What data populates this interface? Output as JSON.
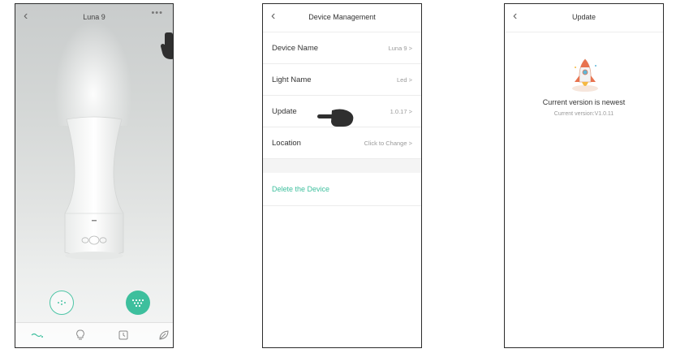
{
  "screen1": {
    "title": "Luna 9",
    "back_icon": "chevron-left-icon",
    "more_label": "•••",
    "mist_buttons": [
      "mist-low-icon",
      "mist-high-icon"
    ],
    "tabs": [
      "mist-tab-icon",
      "light-bulb-icon",
      "alarm-clock-icon",
      "leaf-icon"
    ],
    "accent": "#3dbf9d"
  },
  "screen2": {
    "title": "Device Management",
    "rows": [
      {
        "label": "Device Name",
        "value": "Luna 9 >"
      },
      {
        "label": "Light Name",
        "value": "Led >"
      },
      {
        "label": "Update",
        "value": "1.0.17 >"
      },
      {
        "label": "Location",
        "value": "Click to Change >"
      }
    ],
    "delete_label": "Delete the Device"
  },
  "screen3": {
    "title": "Update",
    "status": "Current version is newest",
    "current_version": "Current version:V1.0.11"
  }
}
